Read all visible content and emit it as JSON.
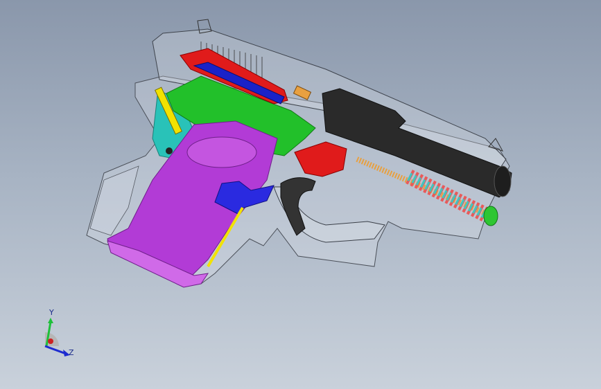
{
  "viewport": {
    "background_top": "#8a97ab",
    "background_bottom": "#c9d1db"
  },
  "model": {
    "subject": "pistol-assembly-transparent-cad",
    "part_colors": {
      "frame": "#d8dde4",
      "slide": "#2a2a2a",
      "magazine": "#b23bd6",
      "trigger": "#333333",
      "trigger_housing": "#e01b1b",
      "locking_block": "#22c02a",
      "firing_pin": "#1a22c8",
      "recoil_spring": "#e85a5a",
      "recoil_spring_inner": "#3ec6c0",
      "guide_rod_tip": "#2ec632",
      "slide_lock": "#2a2ae0",
      "trigger_bar": "#f2e200",
      "trigger_spring": "#e8a040",
      "rear_plate": "#29c2b8"
    }
  },
  "triad": {
    "y_label": "Y",
    "z_label": "Z",
    "y_color": "#1ec03a",
    "z_color": "#1d2bd0",
    "x_color": "#cc2222"
  }
}
